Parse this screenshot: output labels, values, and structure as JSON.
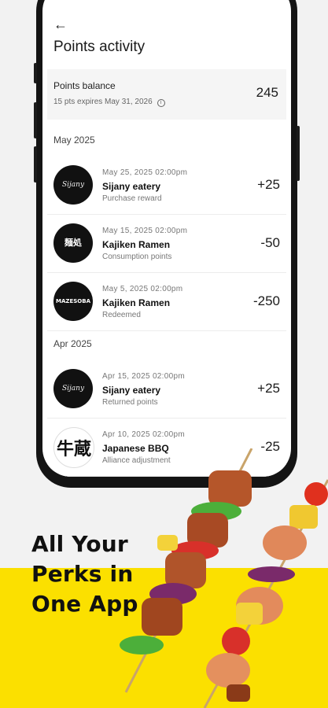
{
  "header": {
    "back_icon": "back-arrow-icon",
    "title": "Points activity"
  },
  "balance": {
    "label": "Points balance",
    "expiry": "15 pts expires May 31, 2026",
    "value": "245"
  },
  "groups": [
    {
      "month": "May 2025",
      "items": [
        {
          "date": "May 25, 2025  02:00pm",
          "merchant": "Sijany eatery",
          "type": "Purchase reward",
          "points": "+25",
          "logo": "Sijany"
        },
        {
          "date": "May 15, 2025  02:00pm",
          "merchant": "Kajiken Ramen",
          "type": "Consumption points",
          "points": "-50",
          "logo": "麺処"
        },
        {
          "date": "May 5, 2025  02:00pm",
          "merchant": "Kajiken Ramen",
          "type": "Redeemed",
          "points": "-250",
          "logo": "MAZESOBA"
        }
      ]
    },
    {
      "month": "Apr 2025",
      "items": [
        {
          "date": "Apr 15, 2025  02:00pm",
          "merchant": "Sijany eatery",
          "type": "Returned points",
          "points": "+25",
          "logo": "Sijany"
        },
        {
          "date": "Apr 10, 2025  02:00pm",
          "merchant": "Japanese BBQ",
          "type": "Alliance adjustment",
          "points": "-25",
          "logo": "牛蔵"
        }
      ]
    }
  ],
  "promo": {
    "line1": "All Your",
    "line2": "Perks in",
    "line3": "One App"
  },
  "colors": {
    "accent_yellow": "#fbe000",
    "background": "#f2f2f2"
  }
}
